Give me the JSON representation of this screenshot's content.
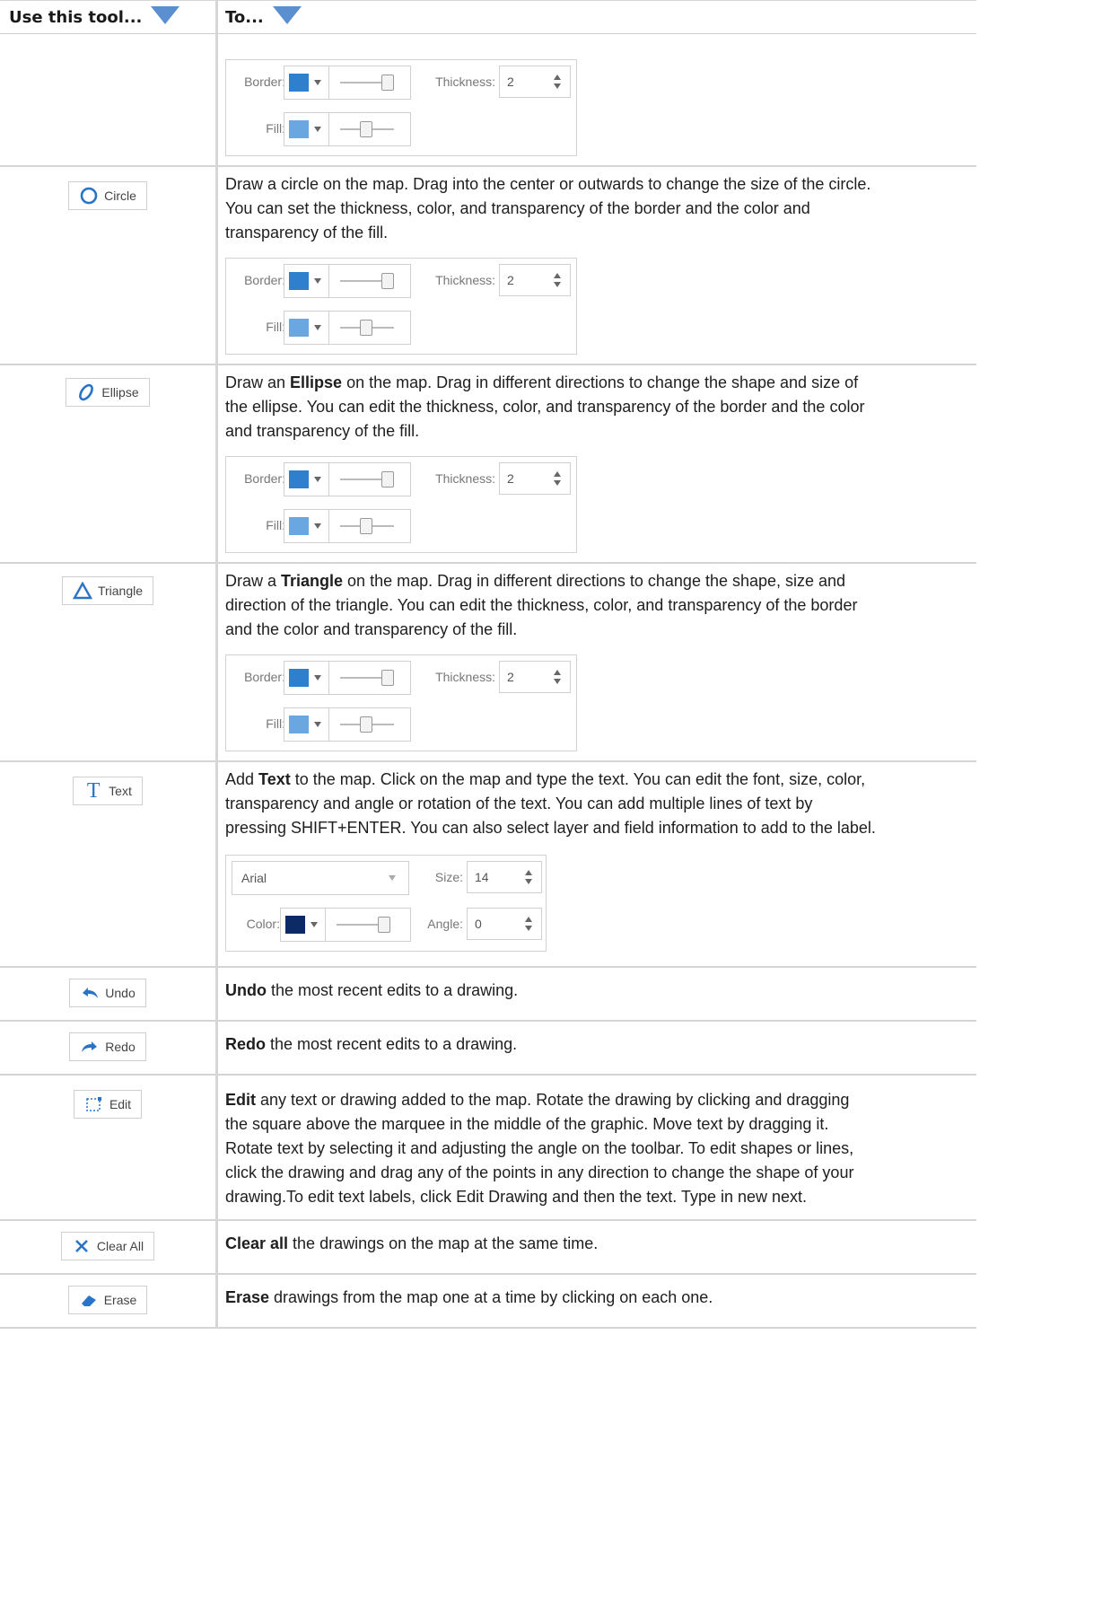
{
  "header": {
    "col1": "Use this tool...",
    "col2": "To..."
  },
  "panel_labels": {
    "border": "Border:",
    "fill": "Fill:",
    "thickness": "Thickness:",
    "thickness_value": "2"
  },
  "colors": {
    "border_swatch": "#2f7fcf",
    "fill_swatch": "#6aa6df",
    "text_swatch": "#0c2a66",
    "header_triangle": "#5b8fd0",
    "icon_blue": "#2a74c8"
  },
  "rows": {
    "circle": {
      "button": "Circle",
      "text": "Draw a circle on the map. Drag into the center or outwards to change the size of the circle.",
      "text2": "You can set the thickness, color, and transparency of the border and the color and",
      "text3": "transparency of the fill."
    },
    "ellipse": {
      "button": "Ellipse",
      "pre": "Draw an ",
      "bold": "Ellipse",
      "post": " on the map. Drag in different directions to change the shape and size of",
      "text2": "the ellipse. You can edit the thickness, color, and transparency of the border and the color",
      "text3": "and transparency of the fill."
    },
    "triangle": {
      "button": "Triangle",
      "pre": "Draw a ",
      "bold": "Triangle",
      "post": " on the map. Drag in different directions to change the shape, size and",
      "text2": "direction of the triangle. You can edit the thickness, color, and transparency of the border",
      "text3": "and the color and transparency of the fill."
    },
    "text": {
      "button": "Text",
      "pre": "Add ",
      "bold": "Text",
      "post": " to the map. Click on the map and type the text. You can edit the font, size, color,",
      "text2": "transparency and angle or rotation of the text. You can add multiple lines of text by",
      "text3": "pressing SHIFT+ENTER. You can also select layer and field information to add to the label.",
      "font": "Arial",
      "size_label": "Size:",
      "size_value": "14",
      "color_label": "Color:",
      "angle_label": "Angle:",
      "angle_value": "0"
    },
    "undo": {
      "button": "Undo",
      "bold": "Undo",
      "post": " the most recent edits to a drawing."
    },
    "redo": {
      "button": "Redo",
      "bold": "Redo",
      "post": " the most recent edits to a drawing."
    },
    "edit": {
      "button": "Edit",
      "bold": "Edit",
      "post": " any text or drawing added to the map. Rotate the drawing by clicking and dragging",
      "text2": "the square above the marquee in the middle of the graphic. Move text by dragging it.",
      "text3": "Rotate text by selecting it and adjusting the angle on the toolbar. To edit shapes or lines,",
      "text4": "click the drawing and drag any of the points in any direction to change the shape of your",
      "text5": "drawing.To edit text labels, click Edit Drawing and then the text. Type in new next."
    },
    "clear": {
      "button": "Clear All",
      "bold": "Clear all",
      "post": " the drawings on the map at the same time."
    },
    "erase": {
      "button": "Erase",
      "bold": "Erase",
      "post": " drawings from the map one at a time by clicking on each one."
    }
  }
}
